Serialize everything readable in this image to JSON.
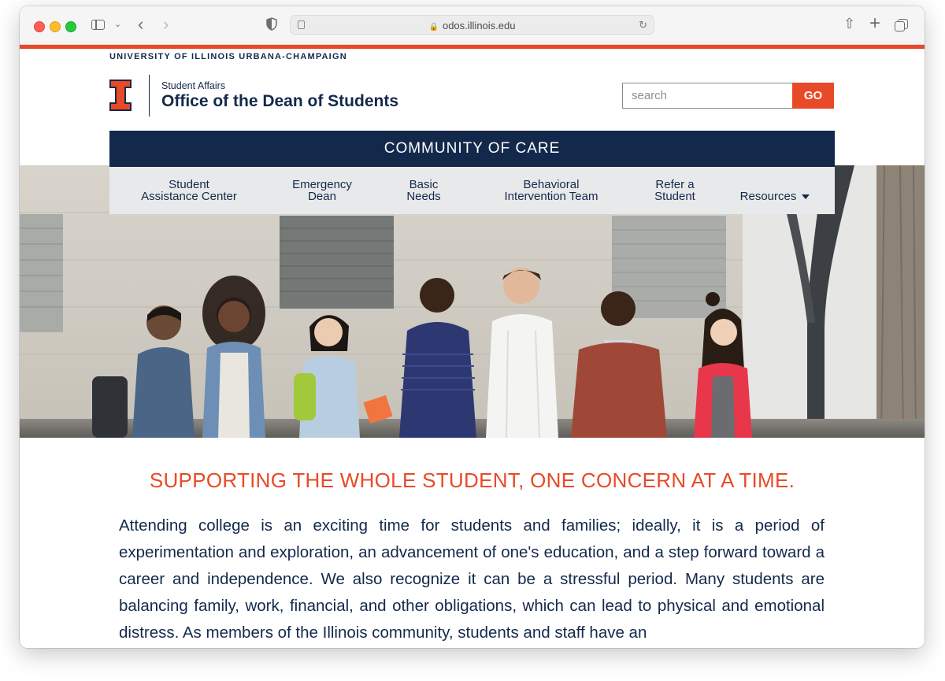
{
  "browser": {
    "url": "odos.illinois.edu"
  },
  "site": {
    "university_name": "UNIVERSITY OF ILLINOIS URBANA-CHAMPAIGN",
    "department_small": "Student Affairs",
    "department_title": "Office of the Dean of Students",
    "brand_colors": {
      "orange": "#e84a27",
      "navy": "#13294b"
    }
  },
  "search": {
    "placeholder": "search",
    "value": "",
    "button_label": "GO"
  },
  "banner": {
    "title": "COMMUNITY OF CARE"
  },
  "nav": {
    "items": [
      {
        "line1": "Student",
        "line2": "Assistance Center"
      },
      {
        "line1": "Emergency",
        "line2": "Dean"
      },
      {
        "line1": "Basic",
        "line2": "Needs"
      },
      {
        "line1": "Behavioral",
        "line2": "Intervention Team"
      },
      {
        "line1": "Refer a",
        "line2": "Student"
      },
      {
        "line1": "",
        "line2": "Resources"
      }
    ]
  },
  "main": {
    "tagline": "SUPPORTING THE WHOLE STUDENT, ONE CONCERN AT A TIME.",
    "intro": "Attending college is an exciting time for students and families; ideally, it is a period of experimentation and exploration, an advancement of one's education, and a step forward toward a career and independence. We also recognize it can be a stressful period. Many students are balancing family, work, financial, and other obligations, which can lead to physical and emotional distress. As members of the Illinois community, students and staff have an"
  }
}
